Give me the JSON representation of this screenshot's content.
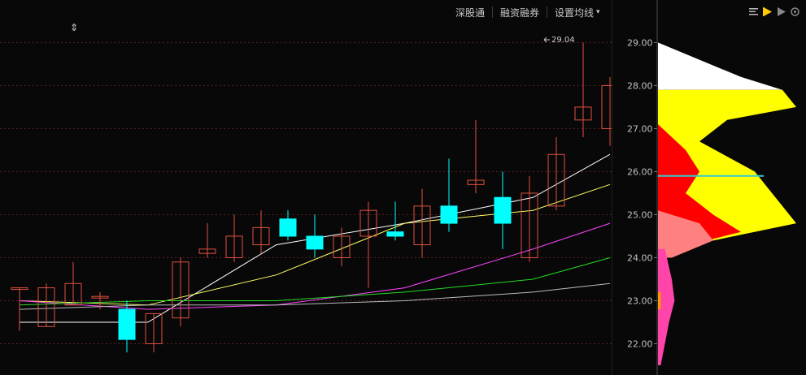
{
  "toolbar": {
    "items": [
      "深股通",
      "融资融券",
      "设置均线"
    ],
    "dropdown_icon": "caret-down-icon"
  },
  "side_toolbar": {
    "icons": [
      "list-icon",
      "flag-icon",
      "play-icon",
      "gear-icon"
    ]
  },
  "colors": {
    "background": "#080808",
    "up_candle": "#e0503f",
    "down_candle": "#00ffff",
    "ma5": "#ffffff",
    "ma10": "#ffff66",
    "ma20": "#ff44ff",
    "ma30": "#22dd22",
    "ma60": "#bbbbbb",
    "grid": "#5a2020",
    "axis_text": "#c0c0c0"
  },
  "chart_data": [
    {
      "type": "candlestick",
      "title": "",
      "annotation": "29.04",
      "ylim": [
        21.5,
        29.8
      ],
      "ohlc": [
        {
          "o": 23.3,
          "h": 23.3,
          "l": 22.3,
          "c": 23.3
        },
        {
          "o": 22.4,
          "h": 23.4,
          "l": 22.4,
          "c": 23.3
        },
        {
          "o": 22.9,
          "h": 23.9,
          "l": 22.9,
          "c": 23.4
        },
        {
          "o": 23.1,
          "h": 23.2,
          "l": 22.8,
          "c": 23.1
        },
        {
          "o": 22.8,
          "h": 23.0,
          "l": 21.8,
          "c": 22.1
        },
        {
          "o": 22.0,
          "h": 22.7,
          "l": 21.8,
          "c": 22.7
        },
        {
          "o": 22.6,
          "h": 24.0,
          "l": 22.4,
          "c": 23.9
        },
        {
          "o": 24.1,
          "h": 24.8,
          "l": 24.0,
          "c": 24.2
        },
        {
          "o": 24.0,
          "h": 25.0,
          "l": 23.9,
          "c": 24.5
        },
        {
          "o": 24.3,
          "h": 25.1,
          "l": 24.1,
          "c": 24.7
        },
        {
          "o": 24.9,
          "h": 25.1,
          "l": 24.4,
          "c": 24.5
        },
        {
          "o": 24.5,
          "h": 25.0,
          "l": 24.0,
          "c": 24.2
        },
        {
          "o": 24.0,
          "h": 24.7,
          "l": 23.8,
          "c": 24.5
        },
        {
          "o": 24.5,
          "h": 25.3,
          "l": 23.3,
          "c": 25.1
        },
        {
          "o": 24.6,
          "h": 25.3,
          "l": 24.4,
          "c": 24.5
        },
        {
          "o": 24.3,
          "h": 25.6,
          "l": 24.0,
          "c": 25.2
        },
        {
          "o": 25.2,
          "h": 26.3,
          "l": 24.6,
          "c": 24.8
        },
        {
          "o": 25.7,
          "h": 27.2,
          "l": 25.5,
          "c": 25.8
        },
        {
          "o": 25.4,
          "h": 26.0,
          "l": 24.2,
          "c": 24.8
        },
        {
          "o": 24.0,
          "h": 25.9,
          "l": 23.9,
          "c": 25.5
        },
        {
          "o": 25.2,
          "h": 26.8,
          "l": 25.1,
          "c": 26.4
        },
        {
          "o": 27.2,
          "h": 29.0,
          "l": 26.8,
          "c": 27.5
        },
        {
          "o": 27.0,
          "h": 28.2,
          "l": 26.6,
          "c": 28.0
        }
      ],
      "x_ticks": [
        "5",
        "10",
        "15",
        "20"
      ],
      "ma": [
        {
          "color": "#ffffff",
          "x": [
            0,
            5,
            10,
            15,
            20,
            23
          ],
          "y": [
            22.5,
            22.5,
            24.3,
            24.8,
            25.4,
            26.4
          ]
        },
        {
          "color": "#ffff66",
          "x": [
            0,
            5,
            10,
            15,
            20,
            23
          ],
          "y": [
            23.0,
            22.9,
            23.6,
            24.8,
            25.1,
            25.7
          ]
        },
        {
          "color": "#ff44ff",
          "x": [
            0,
            5,
            10,
            15,
            20,
            23
          ],
          "y": [
            23.0,
            22.8,
            22.9,
            23.3,
            24.2,
            24.8
          ]
        },
        {
          "color": "#22dd22",
          "x": [
            0,
            5,
            10,
            15,
            20,
            23
          ],
          "y": [
            22.9,
            23.0,
            23.0,
            23.2,
            23.5,
            24.0
          ]
        },
        {
          "color": "#bbbbbb",
          "x": [
            0,
            5,
            10,
            15,
            20,
            23
          ],
          "y": [
            22.8,
            22.9,
            22.9,
            23.0,
            23.2,
            23.4
          ]
        }
      ]
    },
    {
      "type": "area",
      "y_ticks": [
        "29.00",
        "28.00",
        "27.00",
        "26.00",
        "25.00",
        "24.00",
        "23.00",
        "22.00"
      ],
      "ylim": [
        21.5,
        29.8
      ],
      "layers": [
        {
          "color": "#ffffff",
          "y": [
            29.0,
            28.6,
            28.2,
            27.9
          ],
          "value": [
            0.0,
            0.3,
            0.6,
            0.9
          ]
        },
        {
          "color": "#ffff00",
          "y": [
            27.9,
            27.5,
            27.2,
            26.7,
            26.0,
            25.6,
            25.2,
            24.8,
            24.2
          ],
          "value": [
            0.9,
            1.0,
            0.5,
            0.3,
            0.7,
            0.8,
            0.9,
            1.0,
            0.1
          ]
        },
        {
          "color": "#ff0000",
          "y": [
            27.1,
            26.5,
            26.0,
            25.5,
            25.0,
            24.6,
            24.2
          ],
          "value": [
            0.0,
            0.2,
            0.3,
            0.2,
            0.4,
            0.6,
            0.1
          ]
        },
        {
          "color": "#ff8080",
          "y": [
            25.1,
            24.8,
            24.4,
            24.0
          ],
          "value": [
            0.0,
            0.3,
            0.4,
            0.1
          ]
        },
        {
          "color": "#ff44aa",
          "y": [
            24.2,
            23.5,
            23.0,
            22.5,
            22.0,
            21.5
          ],
          "value": [
            0.05,
            0.1,
            0.12,
            0.08,
            0.05,
            0.02
          ]
        },
        {
          "color": "#ff9900",
          "y": [
            23.2,
            22.8
          ],
          "value": [
            0.02,
            0.02
          ]
        }
      ],
      "marker": {
        "price": 25.9,
        "color": "#33cccc"
      }
    }
  ]
}
